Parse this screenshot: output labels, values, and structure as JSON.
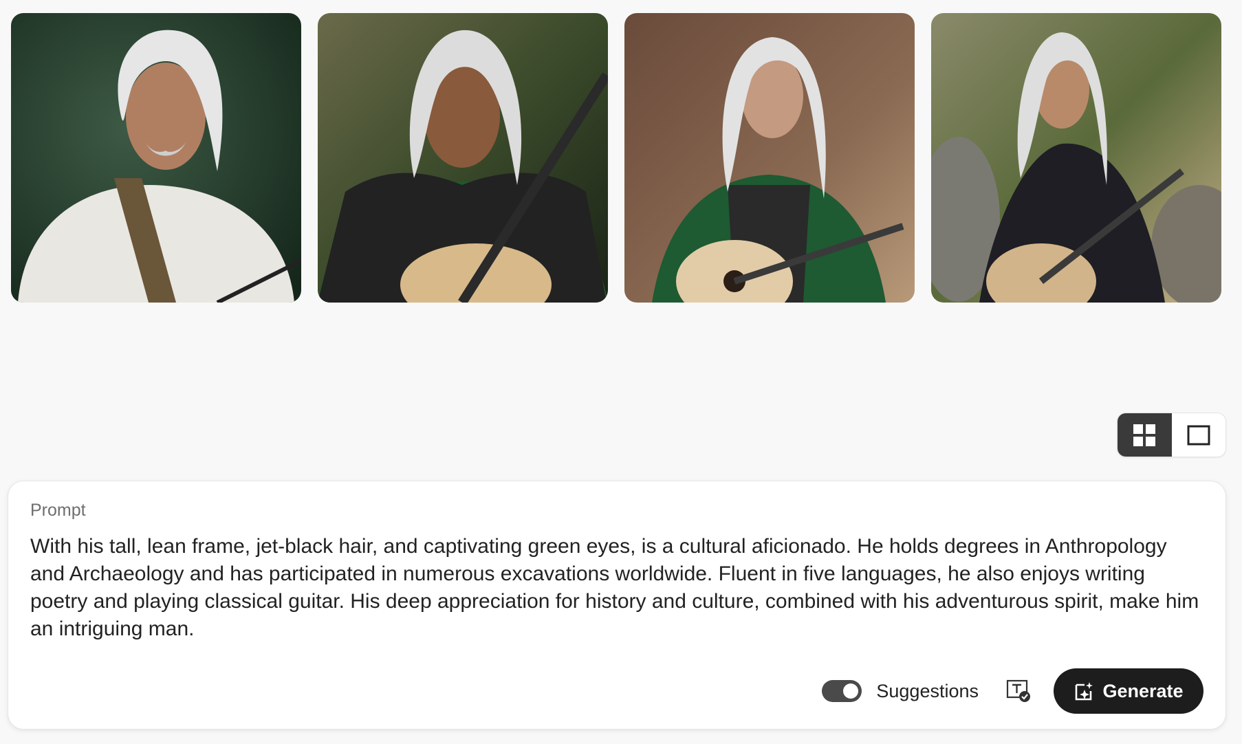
{
  "gallery": {
    "images": [
      {
        "alt": "Portrait of a silver-haired man with a guitar strap in a white shirt"
      },
      {
        "alt": "Silver-haired man with braids holding an acoustic guitar in a green robe"
      },
      {
        "alt": "Silver-haired man in green cloak holding an acoustic guitar among rocks"
      },
      {
        "alt": "Silver-haired man in dark armor holding an acoustic guitar outdoors"
      }
    ]
  },
  "view_toggle": {
    "options": [
      {
        "icon": "grid-view-icon",
        "selected": true
      },
      {
        "icon": "single-view-icon",
        "selected": false
      }
    ]
  },
  "prompt": {
    "label": "Prompt",
    "text": "With his tall, lean frame, jet-black hair, and captivating green eyes, is a cultural aficionado. He holds degrees in Anthropology and Archaeology and has participated in numerous excavations worldwide. Fluent in five languages, he also enjoys writing poetry and playing classical guitar. His deep appreciation for history and culture, combined with his adventurous spirit, make him an intriguing man."
  },
  "controls": {
    "suggestions_label": "Suggestions",
    "suggestions_on": true,
    "text_check_icon": "text-check-icon",
    "generate_label": "Generate",
    "generate_icon": "sparkle-generate-icon"
  },
  "colors": {
    "background": "#f8f8f8",
    "card": "#ffffff",
    "button_dark": "#1d1d1d",
    "toggle_active": "#3a3a3a"
  }
}
